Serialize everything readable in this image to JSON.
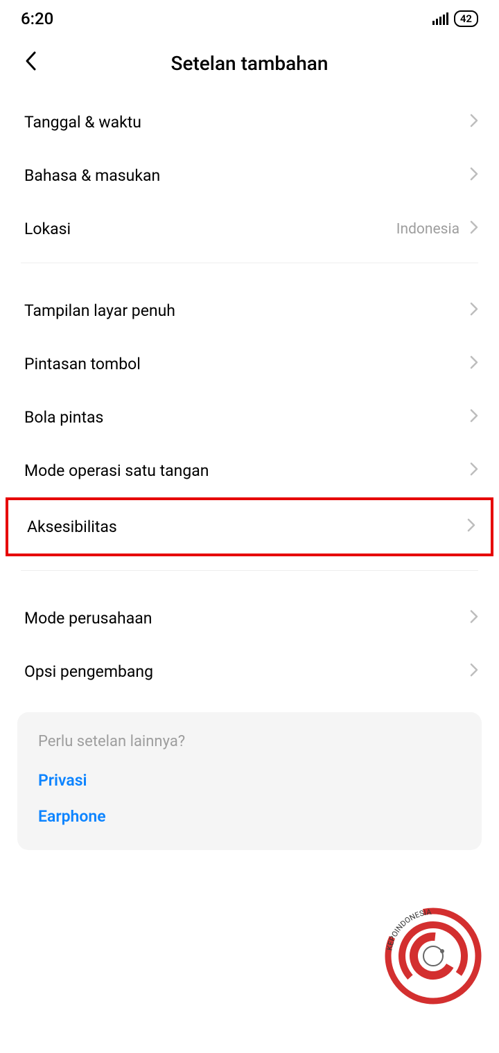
{
  "status": {
    "time": "6:20",
    "battery": "42"
  },
  "header": {
    "title": "Setelan tambahan"
  },
  "groups": [
    {
      "items": [
        {
          "label": "Tanggal & waktu",
          "value": "",
          "highlight": false
        },
        {
          "label": "Bahasa & masukan",
          "value": "",
          "highlight": false
        },
        {
          "label": "Lokasi",
          "value": "Indonesia",
          "highlight": false
        }
      ]
    },
    {
      "items": [
        {
          "label": "Tampilan layar penuh",
          "value": "",
          "highlight": false
        },
        {
          "label": "Pintasan tombol",
          "value": "",
          "highlight": false
        },
        {
          "label": "Bola pintas",
          "value": "",
          "highlight": false
        },
        {
          "label": "Mode operasi satu tangan",
          "value": "",
          "highlight": false
        },
        {
          "label": "Aksesibilitas",
          "value": "",
          "highlight": true
        }
      ]
    },
    {
      "items": [
        {
          "label": "Mode perusahaan",
          "value": "",
          "highlight": false
        },
        {
          "label": "Opsi pengembang",
          "value": "",
          "highlight": false
        }
      ]
    }
  ],
  "suggestions": {
    "title": "Perlu setelan lainnya?",
    "links": [
      "Privasi",
      "Earphone"
    ]
  },
  "watermark": {
    "text": "KEPOINDONESIA"
  }
}
